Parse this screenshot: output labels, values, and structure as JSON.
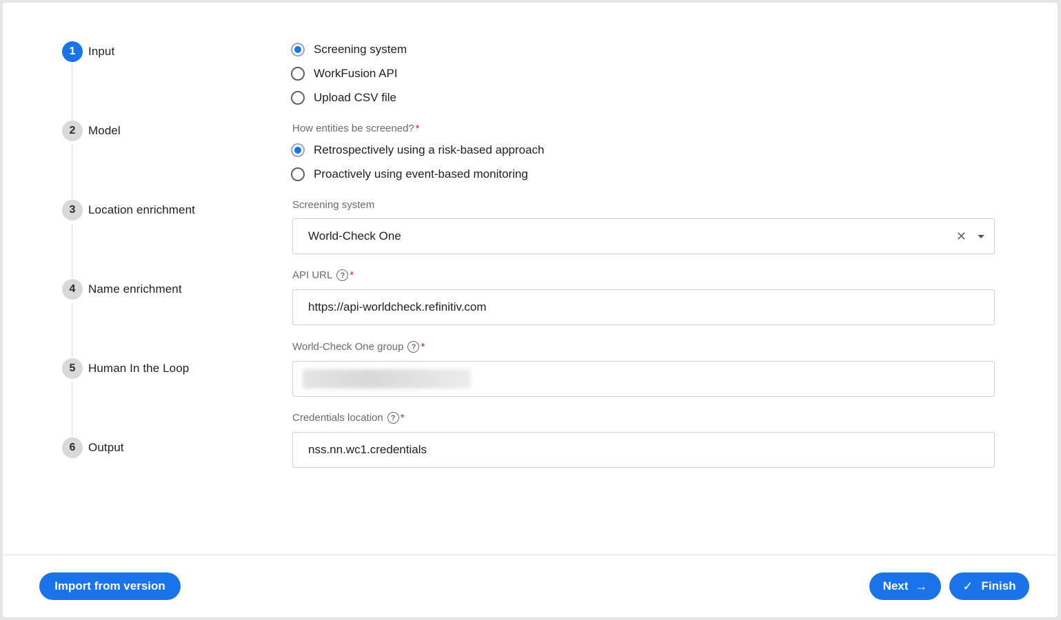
{
  "stepper": {
    "steps": [
      {
        "number": "1",
        "label": "Input"
      },
      {
        "number": "2",
        "label": "Model"
      },
      {
        "number": "3",
        "label": "Location enrichment"
      },
      {
        "number": "4",
        "label": "Name enrichment"
      },
      {
        "number": "5",
        "label": "Human In the Loop"
      },
      {
        "number": "6",
        "label": "Output"
      }
    ],
    "active_step": 1
  },
  "input_source": {
    "options": [
      {
        "label": "Screening system",
        "checked": true
      },
      {
        "label": "WorkFusion API",
        "checked": false
      },
      {
        "label": "Upload CSV file",
        "checked": false
      }
    ]
  },
  "screening_mode": {
    "label": "How entities be screened?",
    "required_mark": "*",
    "options": [
      {
        "label": "Retrospectively using a risk-based approach",
        "checked": true
      },
      {
        "label": "Proactively using event-based monitoring",
        "checked": false
      }
    ]
  },
  "screening_system": {
    "label": "Screening system",
    "value": "World-Check One",
    "clear_icon": "close-icon",
    "dropdown_icon": "caret-down-icon"
  },
  "api_url": {
    "label": "API URL",
    "required_mark": "*",
    "help_icon": "question-circle-icon",
    "value": "https://api-worldcheck.refinitiv.com"
  },
  "group": {
    "label": "World-Check One group",
    "required_mark": "*",
    "help_icon": "question-circle-icon",
    "value_redacted": true
  },
  "credentials": {
    "label": "Credentials location",
    "required_mark": "*",
    "help_icon": "question-circle-icon",
    "value": "nss.nn.wc1.credentials"
  },
  "footer": {
    "import_label": "Import from version",
    "next_label": "Next",
    "finish_label": "Finish",
    "next_icon": "arrow-right-icon",
    "finish_icon": "check-icon"
  },
  "colors": {
    "primary": "#1a73e8",
    "required": "#c62828"
  }
}
